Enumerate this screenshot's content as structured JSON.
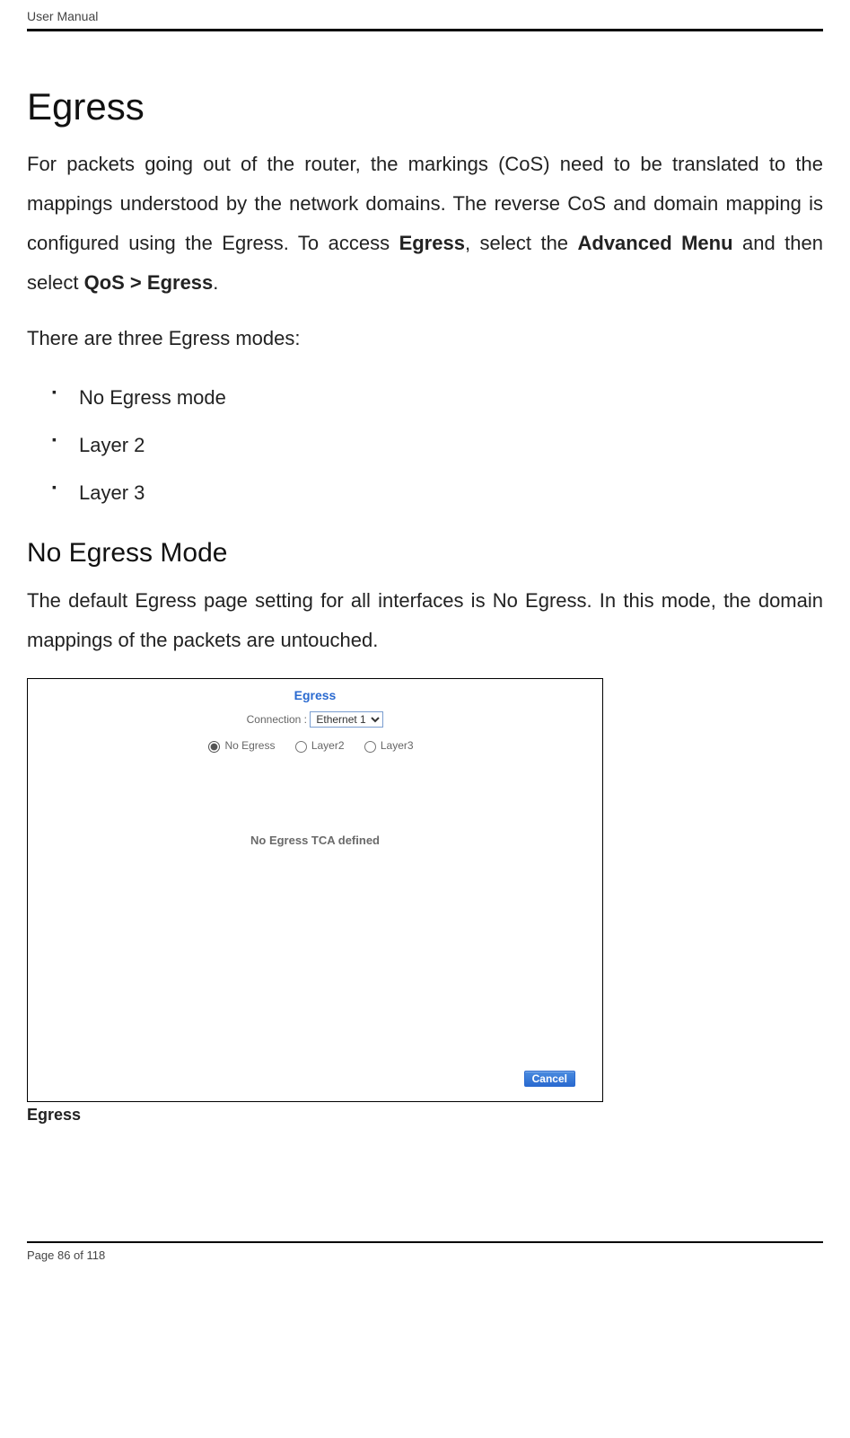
{
  "header": {
    "text": "User Manual"
  },
  "section": {
    "title": "Egress",
    "para1_a": "For packets going out of the router, the markings (CoS) need to be translated to the mappings understood by the network domains. The reverse CoS and domain mapping is configured using the Egress. To access ",
    "bold1": "Egress",
    "para1_b": ", select the ",
    "bold2": "Advanced Menu",
    "para1_c": " and then select ",
    "bold3": "QoS > Egress",
    "para1_d": ".",
    "intro": "There are three Egress modes:",
    "modes": [
      "No Egress mode",
      "Layer 2",
      "Layer 3"
    ]
  },
  "subsection": {
    "title": "No Egress Mode",
    "para": "The default Egress page setting for all interfaces is No Egress. In this mode, the domain mappings of the packets are untouched."
  },
  "figure": {
    "title": "Egress",
    "connection_label": "Connection :",
    "connection_value": "Ethernet 1",
    "radios": {
      "no_egress": "No Egress",
      "layer2": "Layer2",
      "layer3": "Layer3"
    },
    "selected_radio": "no_egress",
    "message": "No Egress TCA defined",
    "cancel": "Cancel",
    "caption": "Egress"
  },
  "footer": {
    "text": "Page 86 of 118"
  }
}
